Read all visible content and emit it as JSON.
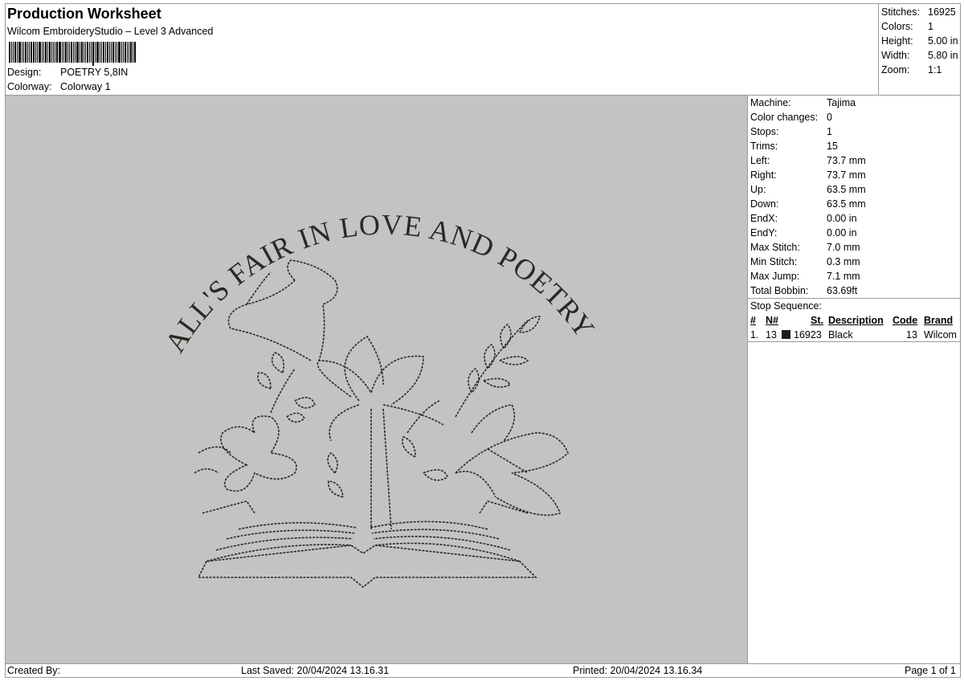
{
  "header": {
    "title": "Production Worksheet",
    "subtitle": "Wilcom EmbroideryStudio – Level 3 Advanced",
    "design_label": "Design:",
    "design_value": "POETRY 5,8IN",
    "colorway_label": "Colorway:",
    "colorway_value": "Colorway 1"
  },
  "summary": [
    {
      "label": "Stitches:",
      "value": "16925"
    },
    {
      "label": "Colors:",
      "value": "1"
    },
    {
      "label": "Height:",
      "value": "5.00 in"
    },
    {
      "label": "Width:",
      "value": "5.80 in"
    },
    {
      "label": "Zoom:",
      "value": "1:1"
    }
  ],
  "machine_info": [
    {
      "label": "Machine:",
      "value": "Tajima"
    },
    {
      "label": "Color changes:",
      "value": "0"
    },
    {
      "label": "Stops:",
      "value": "1"
    },
    {
      "label": "Trims:",
      "value": "15"
    },
    {
      "label": "Left:",
      "value": "73.7 mm"
    },
    {
      "label": "Right:",
      "value": "73.7 mm"
    },
    {
      "label": "Up:",
      "value": "63.5 mm"
    },
    {
      "label": "Down:",
      "value": "63.5 mm"
    },
    {
      "label": "EndX:",
      "value": "0.00 in"
    },
    {
      "label": "EndY:",
      "value": "0.00 in"
    },
    {
      "label": "Max Stitch:",
      "value": "7.0 mm"
    },
    {
      "label": "Min Stitch:",
      "value": "0.3 mm"
    },
    {
      "label": "Max Jump:",
      "value": "7.1 mm"
    },
    {
      "label": "Total Bobbin:",
      "value": "63.69ft"
    }
  ],
  "stop_sequence": {
    "label": "Stop Sequence:",
    "columns": {
      "num": "#",
      "needle": "N#",
      "stitches": "St.",
      "description": "Description",
      "code": "Code",
      "brand": "Brand"
    },
    "rows": [
      {
        "num": "1.",
        "needle": "13",
        "color": "#1a1a1a",
        "stitches": "16923",
        "description": "Black",
        "code": "13",
        "brand": "Wilcom"
      }
    ]
  },
  "design": {
    "background": "#c3c3c3",
    "thread_color": "#2b2923",
    "text": "ALL'S FAIR IN LOVE AND POETRY"
  },
  "footer": {
    "created_by": "Created By:",
    "last_saved": "Last Saved: 20/04/2024 13.16.31",
    "printed": "Printed: 20/04/2024 13.16.34",
    "page": "Page 1 of 1"
  }
}
